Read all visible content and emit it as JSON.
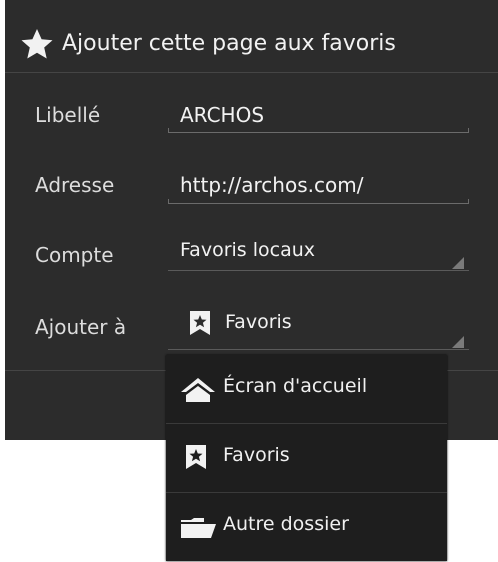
{
  "dialog": {
    "title": "Ajouter cette page aux favoris",
    "title_icon": "star-icon"
  },
  "form": {
    "label": {
      "caption": "Libellé",
      "value": "ARCHOS"
    },
    "address": {
      "caption": "Adresse",
      "value": "http://archos.com/"
    },
    "account": {
      "caption": "Compte",
      "value": "Favoris locaux"
    },
    "add_to": {
      "caption": "Ajouter à",
      "value": "Favoris",
      "icon": "bookmark-icon"
    }
  },
  "dropdown": {
    "options": [
      {
        "label": "Écran d'accueil",
        "icon": "home-icon"
      },
      {
        "label": "Favoris",
        "icon": "bookmark-icon"
      },
      {
        "label": "Autre dossier",
        "icon": "folder-icon"
      }
    ]
  },
  "colors": {
    "dialog_bg": "#2c2c2c",
    "dropdown_bg": "#1e1e1e",
    "text": "#f2f2f2"
  }
}
